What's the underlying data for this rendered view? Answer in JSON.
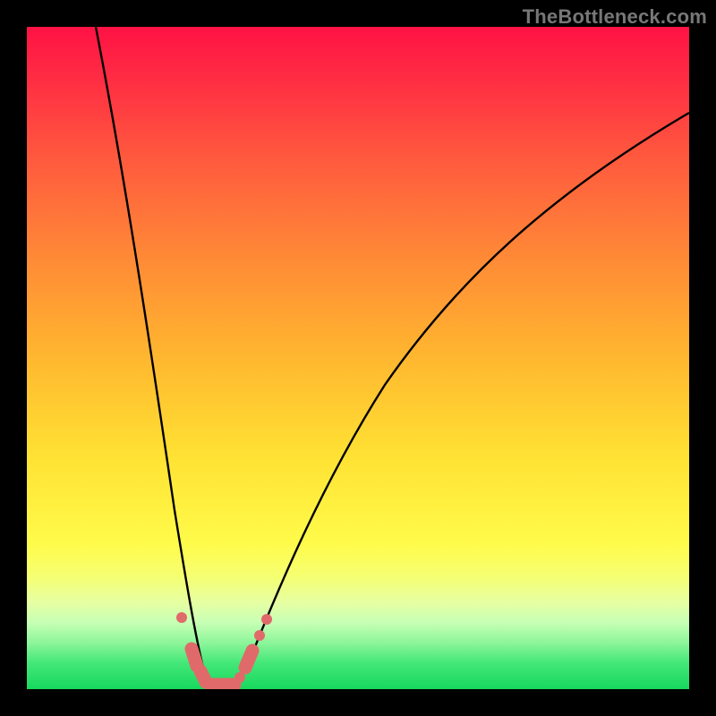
{
  "watermark": "TheBottleneck.com",
  "chart_data": {
    "type": "line",
    "title": "",
    "xlabel": "",
    "ylabel": "",
    "xlim": [
      0,
      100
    ],
    "ylim": [
      0,
      100
    ],
    "grid": false,
    "legend": false,
    "annotations": [],
    "series": [
      {
        "name": "left-branch",
        "x": [
          10,
          12,
          14,
          16,
          18,
          20,
          22,
          23,
          24,
          25,
          26
        ],
        "y": [
          100,
          82,
          64,
          47,
          33,
          21,
          12,
          8,
          5,
          3,
          1
        ]
      },
      {
        "name": "right-branch",
        "x": [
          30,
          32,
          35,
          40,
          46,
          54,
          62,
          72,
          84,
          96,
          100
        ],
        "y": [
          1,
          5,
          12,
          22,
          34,
          46,
          56,
          66,
          76,
          84,
          87
        ]
      },
      {
        "name": "valley-floor",
        "x": [
          25,
          26,
          27,
          28,
          29,
          30
        ],
        "y": [
          1,
          0.6,
          0.4,
          0.4,
          0.6,
          1
        ]
      }
    ],
    "highlight_points": [
      {
        "x": 22.5,
        "y": 10
      },
      {
        "x": 24,
        "y": 5
      },
      {
        "x": 25,
        "y": 2.5
      },
      {
        "x": 26,
        "y": 1
      },
      {
        "x": 27.5,
        "y": 0.5
      },
      {
        "x": 29,
        "y": 1
      },
      {
        "x": 30,
        "y": 2.5
      },
      {
        "x": 31.5,
        "y": 6
      },
      {
        "x": 33,
        "y": 10
      }
    ],
    "background_gradient": {
      "top": "#ff1245",
      "upper_mid": "#ffb72f",
      "lower_mid": "#fffb4a",
      "bottom": "#17d85d"
    }
  }
}
